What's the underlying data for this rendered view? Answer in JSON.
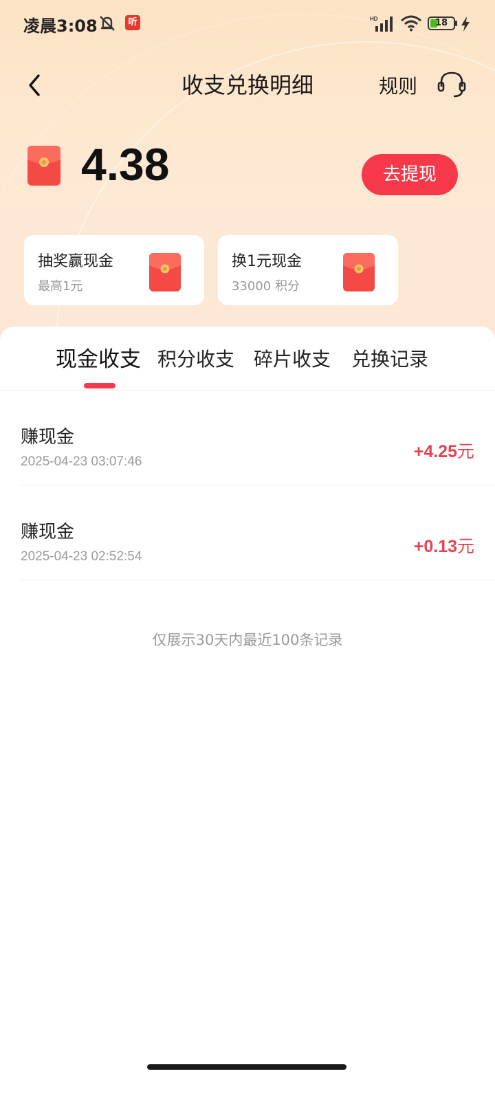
{
  "status_bar": {
    "time": "凌晨3:08",
    "app_badge": "听",
    "battery": "18",
    "icons": [
      "mute-icon",
      "signal-icon",
      "wifi-icon",
      "battery-icon",
      "charging-icon"
    ]
  },
  "header": {
    "title": "收支兑换明细",
    "rules_label": "规则",
    "icons": [
      "back-icon",
      "customer-service-icon"
    ]
  },
  "balance": {
    "amount": "4.38",
    "withdraw_label": "去提现",
    "icon": "red-envelope-icon"
  },
  "cards": [
    {
      "title": "抽奖赢现金",
      "subtitle": "最高1元",
      "icon": "red-envelope-icon"
    },
    {
      "title": "换1元现金",
      "subtitle": "33000 积分",
      "icon": "red-envelope-icon"
    }
  ],
  "tabs": [
    {
      "label": "现金收支",
      "active": true
    },
    {
      "label": "积分收支",
      "active": false
    },
    {
      "label": "碎片收支",
      "active": false
    },
    {
      "label": "兑换记录",
      "active": false
    }
  ],
  "records": [
    {
      "title": "赚现金",
      "time": "2025-04-23 03:07:46",
      "amount": "+4.25",
      "unit": "元"
    },
    {
      "title": "赚现金",
      "time": "2025-04-23 02:52:54",
      "amount": "+0.13",
      "unit": "元"
    }
  ],
  "footer_note": "仅展示30天内最近100条记录",
  "colors": {
    "accent": "#f5394b",
    "amount_red": "#e9414e",
    "header_bg": "#fde3c4"
  }
}
